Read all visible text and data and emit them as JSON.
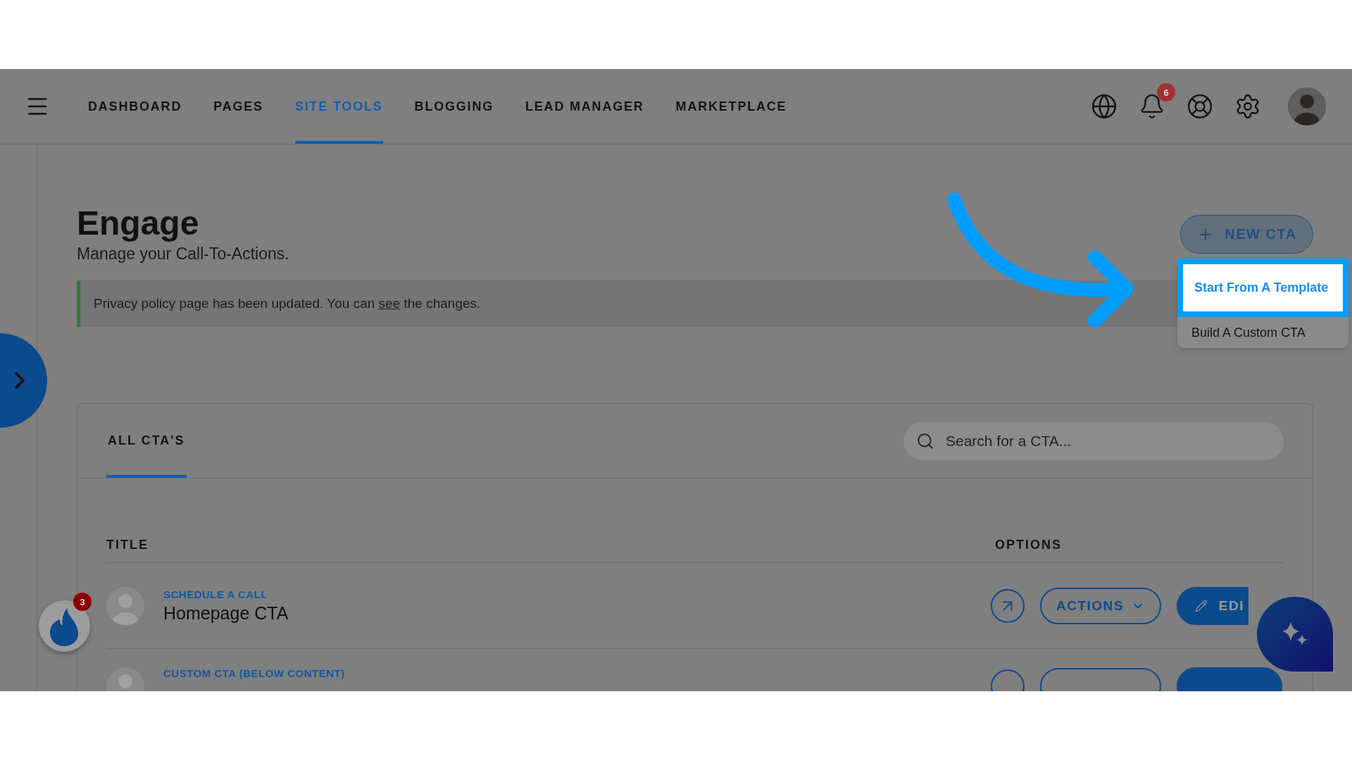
{
  "nav": {
    "items": [
      {
        "label": "DASHBOARD",
        "selected": false
      },
      {
        "label": "PAGES",
        "selected": false
      },
      {
        "label": "SITE TOOLS",
        "selected": true
      },
      {
        "label": "BLOGGING",
        "selected": false
      },
      {
        "label": "LEAD MANAGER",
        "selected": false
      },
      {
        "label": "MARKETPLACE",
        "selected": false
      }
    ],
    "notification_count": "6"
  },
  "page": {
    "title": "Engage",
    "subtitle": "Manage your Call-To-Actions."
  },
  "alert": {
    "text": "Privacy policy page has been updated. You can",
    "link": "see",
    "text_after": "the changes."
  },
  "new_cta_button": {
    "label": "NEW CTA"
  },
  "dropdown": {
    "items": [
      {
        "label": "Start From A Template",
        "selected": true
      },
      {
        "label": "Build A Custom CTA",
        "selected": false
      }
    ]
  },
  "tabs": [
    {
      "label": "ALL CTA'S",
      "selected": true
    }
  ],
  "search": {
    "placeholder": "Search for a CTA..."
  },
  "table": {
    "columns": [
      "TITLE",
      "OPTIONS"
    ],
    "rows": [
      {
        "category": "SCHEDULE A CALL",
        "title": "Homepage CTA",
        "actions_label": "ACTIONS",
        "edit_label": "EDI"
      },
      {
        "category": "CUSTOM CTA (BELOW CONTENT)"
      }
    ]
  },
  "floating_badge": {
    "count": "3"
  }
}
